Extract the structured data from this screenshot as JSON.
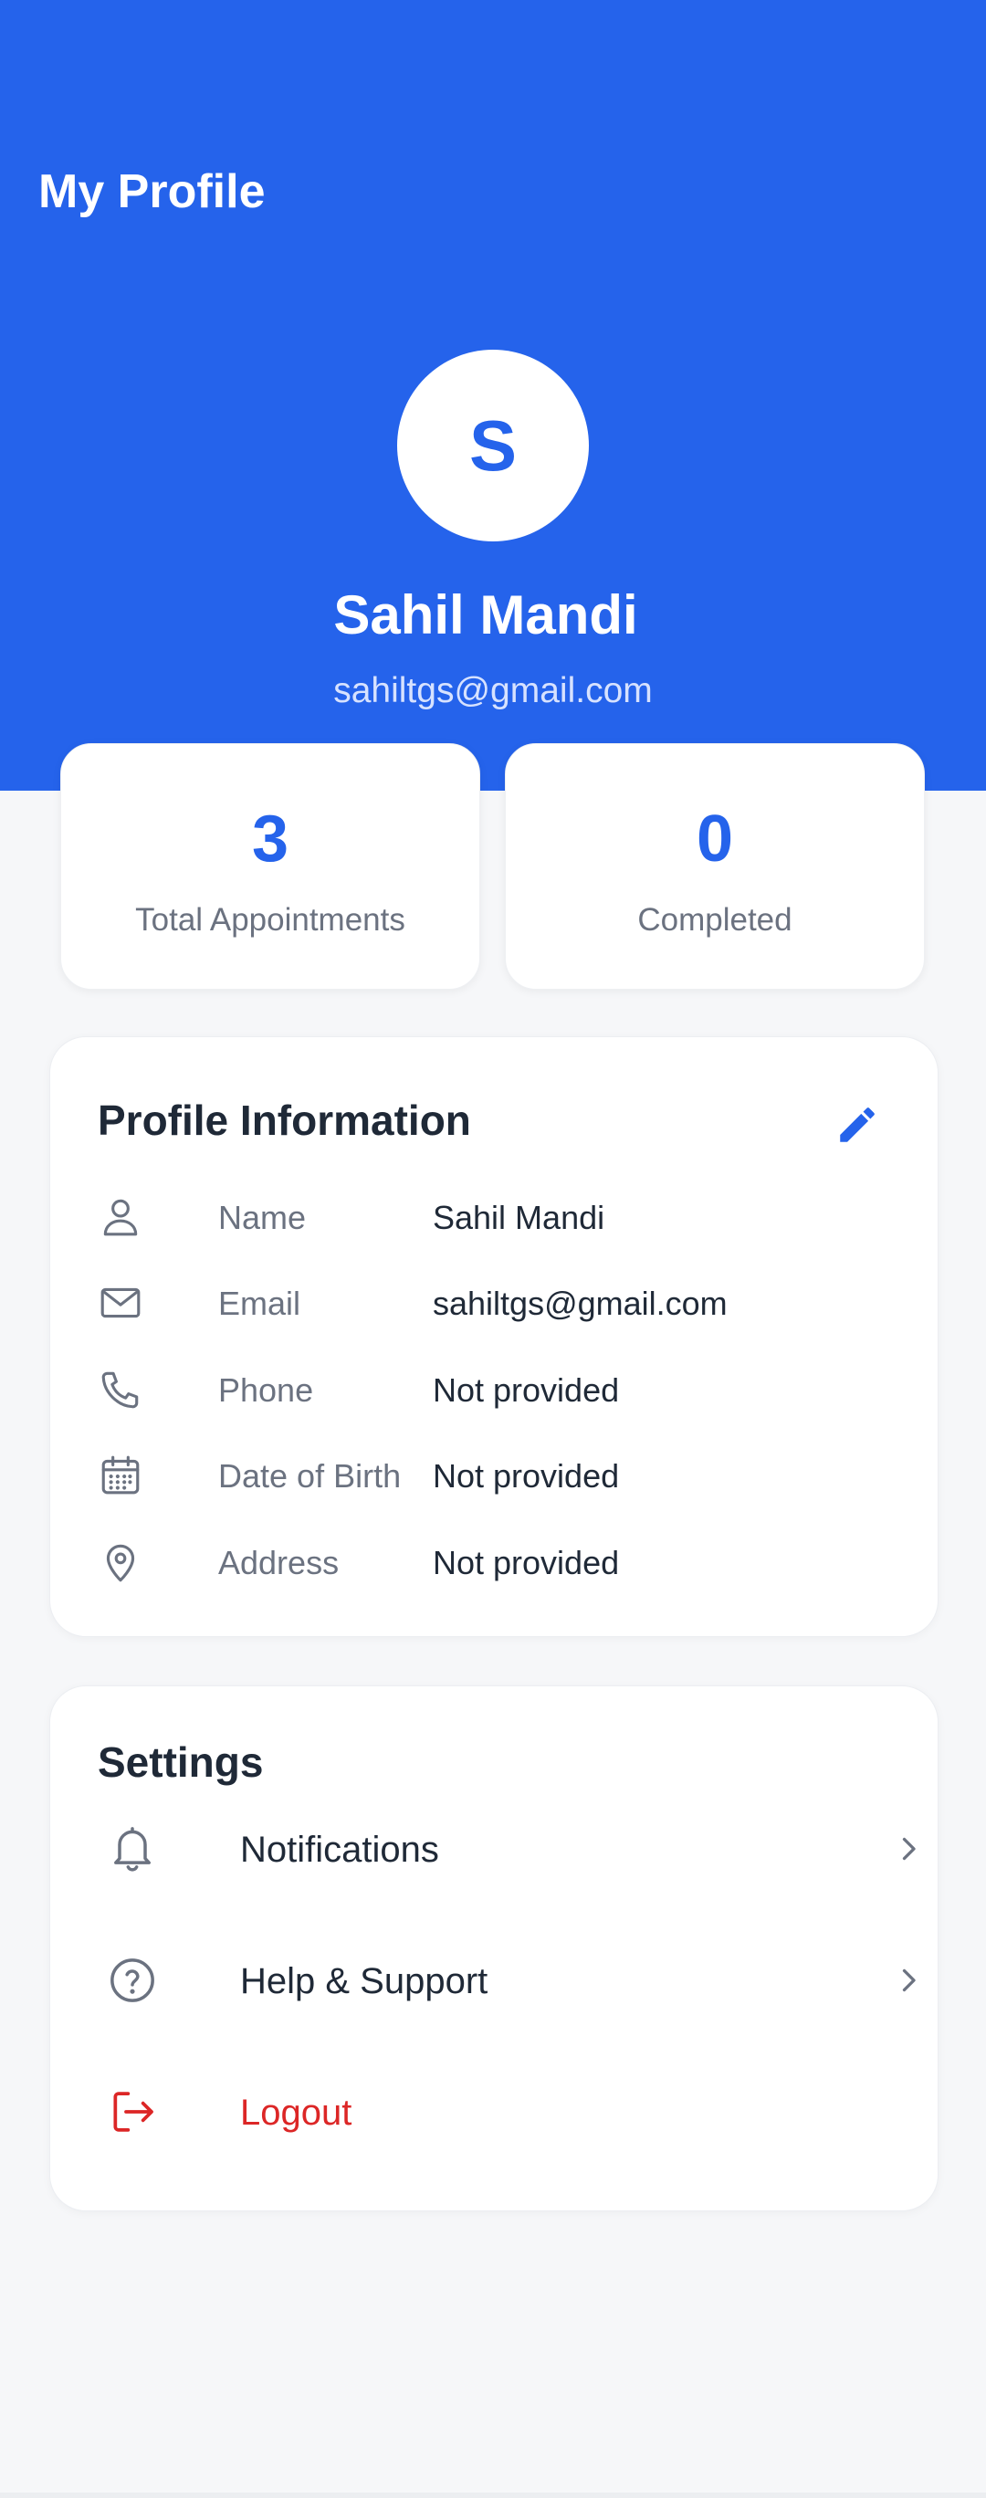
{
  "header": {
    "title": "My Profile",
    "avatar_initial": "S",
    "user_name": "Sahil Mandi",
    "user_email": "sahiltgs@gmail.com"
  },
  "stats": [
    {
      "value": "3",
      "label": "Total Appointments"
    },
    {
      "value": "0",
      "label": "Completed"
    }
  ],
  "profile_info": {
    "title": "Profile Information",
    "edit_icon": "pencil-icon",
    "rows": [
      {
        "icon": "person-icon",
        "label": "Name",
        "value": "Sahil Mandi"
      },
      {
        "icon": "mail-icon",
        "label": "Email",
        "value": "sahiltgs@gmail.com"
      },
      {
        "icon": "phone-icon",
        "label": "Phone",
        "value": "Not provided"
      },
      {
        "icon": "calendar-icon",
        "label": "Date of Birth",
        "value": "Not provided"
      },
      {
        "icon": "location-pin-icon",
        "label": "Address",
        "value": "Not provided"
      }
    ]
  },
  "settings": {
    "title": "Settings",
    "items": [
      {
        "icon": "bell-icon",
        "label": "Notifications"
      },
      {
        "icon": "help-circle-icon",
        "label": "Help & Support"
      },
      {
        "icon": "logout-icon",
        "label": "Logout"
      }
    ]
  },
  "colors": {
    "primary": "#2563eb",
    "danger": "#dc2626",
    "background": "#f6f7f9"
  }
}
